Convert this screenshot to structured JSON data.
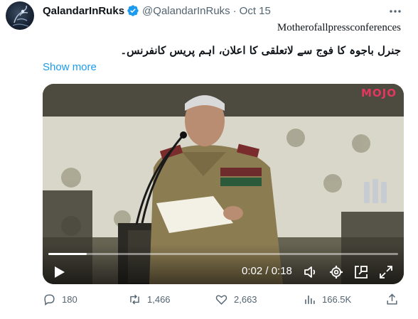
{
  "author": {
    "display_name": "QalandarInRuks",
    "handle": "@QalandarInRuks",
    "date": "Oct 15",
    "avatar_icon": "avatar-image",
    "verified_icon": "verified-badge-icon"
  },
  "tweet": {
    "line1": "Motherofallpressconferences",
    "line2": "جنرل باجوہ کا فوج سے لاتعلقی کا اعلان، اہم پریس کانفرنس۔",
    "show_more": "Show more"
  },
  "video": {
    "logo_text": "MOJO",
    "time": "0:02 / 0:18",
    "progress": 0.11,
    "icons": [
      "play-icon",
      "volume-icon",
      "settings-icon",
      "pip-icon",
      "fullscreen-icon"
    ]
  },
  "actions": {
    "replies": "180",
    "retweets": "1,466",
    "likes": "2,663",
    "views": "166.5K"
  },
  "colors": {
    "accent": "#1d9bf0",
    "secondary_text": "#536471",
    "logo": "#e4375f"
  }
}
